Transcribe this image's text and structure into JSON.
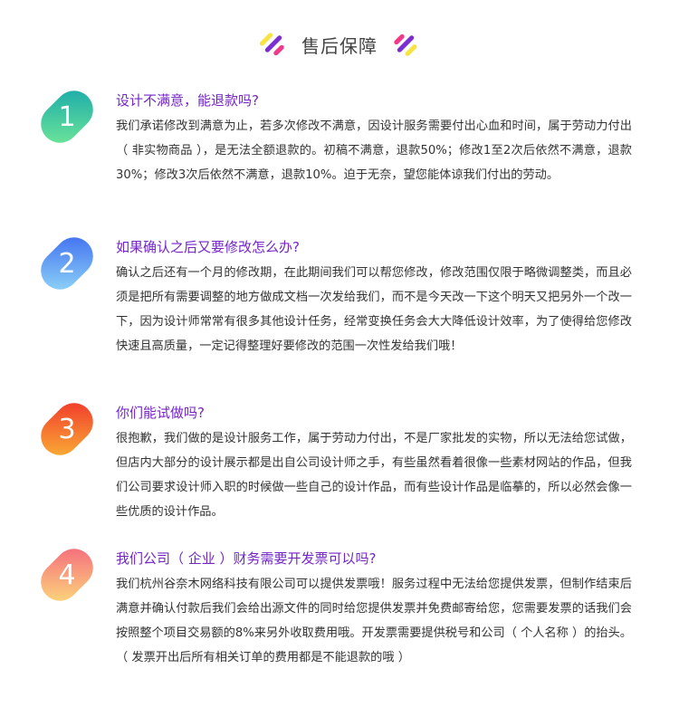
{
  "header": {
    "title": "售后保障",
    "icon": "decorative-stripes-icon"
  },
  "sections": [
    {
      "number": "1",
      "title": "设计不满意，能退款吗?",
      "body": "我们承诺修改到满意为止，若多次修改不满意，因设计服务需要付出心血和时间，属于劳动力付出（ 非实物商品 ），是无法全额退款的。初稿不满意，退款50%；修改1至2次后依然不满意，退款30%；修改3次后依然不满意，退款10%。迫于无奈，望您能体谅我们付出的劳动。",
      "colors": [
        "#15a6ab",
        "#73ea97"
      ]
    },
    {
      "number": "2",
      "title": "如果确认之后又要修改怎么办?",
      "body": "确认之后还有一个月的修改期，在此期间我们可以帮您修改，修改范围仅限于略微调整类，而且必须是把所有需要调整的地方做成文档一次发给我们，而不是今天改一下这个明天又把另外一个改一下，因为设计师常常有很多其他设计任务，经常变换任务会大大降低设计效率，为了使得给您修改快速且高质量，一定记得整理好要修改的范围一次性发给我们哦！",
      "colors": [
        "#3b68f0",
        "#94dcf8"
      ]
    },
    {
      "number": "3",
      "title": "你们能试做吗?",
      "body": "很抱歉，我们做的是设计服务工作，属于劳动力付出，不是厂家批发的实物，所以无法给您试做，但店内大部分的设计展示都是出自公司设计师之手，有些虽然看着很像一些素材网站的作品，但我们公司要求设计师入职的时候做一些自己的设计作品，而有些设计作品是临摹的，所以必然会像一些优质的设计作品。",
      "colors": [
        "#f0302c",
        "#fab735"
      ]
    },
    {
      "number": "4",
      "title": "我们公司（ 企业 ）财务需要开发票可以吗?",
      "body": "我们杭州谷奈木网络科技有限公司可以提供发票哦！服务过程中无法给您提供发票，但制作结束后满意并确认付款后我们会给出源文件的同时给您提供发票并免费邮寄给您，您需要发票的话我们会按照整个项目交易额的8%来另外收取费用哦。开发票需要提供税号和公司（ 个人名称 ）的抬头。（ 发票开出后所有相关订单的费用都是不能退款的哦 ）",
      "colors": [
        "#f4637e",
        "#fce07a"
      ]
    }
  ]
}
